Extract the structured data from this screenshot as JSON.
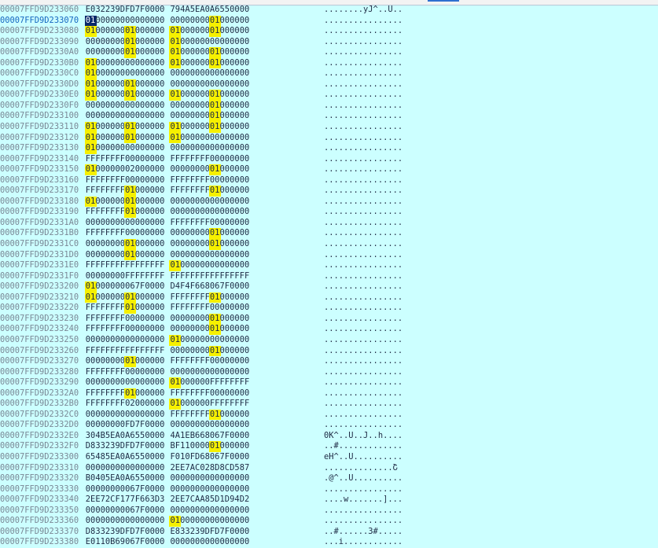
{
  "hex_view": {
    "rows": [
      {
        "address": "00007FFD9D233060",
        "bytes": [
          "E0",
          "32",
          "23",
          "9D",
          "FD",
          "7F",
          "00",
          "00",
          "79",
          "4A",
          "5E",
          "A0",
          "A6",
          "55",
          "00",
          "00"
        ],
        "ascii": "........yJ^..U.."
      },
      {
        "address": "00007FFD9D233070",
        "bytes": [
          "01",
          "00",
          "00",
          "00",
          "00",
          "00",
          "00",
          "00",
          "00",
          "00",
          "00",
          "00",
          "01",
          "00",
          "00",
          "00"
        ],
        "ascii": "................",
        "current": true
      },
      {
        "address": "00007FFD9D233080",
        "bytes": [
          "01",
          "00",
          "00",
          "00",
          "01",
          "00",
          "00",
          "00",
          "01",
          "00",
          "00",
          "00",
          "01",
          "00",
          "00",
          "00"
        ],
        "ascii": "................"
      },
      {
        "address": "00007FFD9D233090",
        "bytes": [
          "00",
          "00",
          "00",
          "00",
          "01",
          "00",
          "00",
          "00",
          "01",
          "00",
          "00",
          "00",
          "00",
          "00",
          "00",
          "00"
        ],
        "ascii": "................"
      },
      {
        "address": "00007FFD9D2330A0",
        "bytes": [
          "00",
          "00",
          "00",
          "00",
          "01",
          "00",
          "00",
          "00",
          "01",
          "00",
          "00",
          "00",
          "01",
          "00",
          "00",
          "00"
        ],
        "ascii": "................"
      },
      {
        "address": "00007FFD9D2330B0",
        "bytes": [
          "01",
          "00",
          "00",
          "00",
          "00",
          "00",
          "00",
          "00",
          "01",
          "00",
          "00",
          "00",
          "01",
          "00",
          "00",
          "00"
        ],
        "ascii": "................"
      },
      {
        "address": "00007FFD9D2330C0",
        "bytes": [
          "01",
          "00",
          "00",
          "00",
          "00",
          "00",
          "00",
          "00",
          "00",
          "00",
          "00",
          "00",
          "00",
          "00",
          "00",
          "00"
        ],
        "ascii": "................"
      },
      {
        "address": "00007FFD9D2330D0",
        "bytes": [
          "01",
          "00",
          "00",
          "00",
          "01",
          "00",
          "00",
          "00",
          "00",
          "00",
          "00",
          "00",
          "00",
          "00",
          "00",
          "00"
        ],
        "ascii": "................"
      },
      {
        "address": "00007FFD9D2330E0",
        "bytes": [
          "01",
          "00",
          "00",
          "00",
          "01",
          "00",
          "00",
          "00",
          "01",
          "00",
          "00",
          "00",
          "01",
          "00",
          "00",
          "00"
        ],
        "ascii": "................"
      },
      {
        "address": "00007FFD9D2330F0",
        "bytes": [
          "00",
          "00",
          "00",
          "00",
          "00",
          "00",
          "00",
          "00",
          "00",
          "00",
          "00",
          "00",
          "01",
          "00",
          "00",
          "00"
        ],
        "ascii": "................"
      },
      {
        "address": "00007FFD9D233100",
        "bytes": [
          "00",
          "00",
          "00",
          "00",
          "00",
          "00",
          "00",
          "00",
          "00",
          "00",
          "00",
          "00",
          "01",
          "00",
          "00",
          "00"
        ],
        "ascii": "................"
      },
      {
        "address": "00007FFD9D233110",
        "bytes": [
          "01",
          "00",
          "00",
          "00",
          "01",
          "00",
          "00",
          "00",
          "01",
          "00",
          "00",
          "00",
          "01",
          "00",
          "00",
          "00"
        ],
        "ascii": "................"
      },
      {
        "address": "00007FFD9D233120",
        "bytes": [
          "01",
          "00",
          "00",
          "00",
          "01",
          "00",
          "00",
          "00",
          "01",
          "00",
          "00",
          "00",
          "00",
          "00",
          "00",
          "00"
        ],
        "ascii": "................"
      },
      {
        "address": "00007FFD9D233130",
        "bytes": [
          "01",
          "00",
          "00",
          "00",
          "00",
          "00",
          "00",
          "00",
          "00",
          "00",
          "00",
          "00",
          "00",
          "00",
          "00",
          "00"
        ],
        "ascii": "................"
      },
      {
        "address": "00007FFD9D233140",
        "bytes": [
          "FF",
          "FF",
          "FF",
          "FF",
          "00",
          "00",
          "00",
          "00",
          "FF",
          "FF",
          "FF",
          "FF",
          "00",
          "00",
          "00",
          "00"
        ],
        "ascii": "................"
      },
      {
        "address": "00007FFD9D233150",
        "bytes": [
          "01",
          "00",
          "00",
          "00",
          "02",
          "00",
          "00",
          "00",
          "00",
          "00",
          "00",
          "00",
          "01",
          "00",
          "00",
          "00"
        ],
        "ascii": "................"
      },
      {
        "address": "00007FFD9D233160",
        "bytes": [
          "FF",
          "FF",
          "FF",
          "FF",
          "00",
          "00",
          "00",
          "00",
          "FF",
          "FF",
          "FF",
          "FF",
          "00",
          "00",
          "00",
          "00"
        ],
        "ascii": "................"
      },
      {
        "address": "00007FFD9D233170",
        "bytes": [
          "FF",
          "FF",
          "FF",
          "FF",
          "01",
          "00",
          "00",
          "00",
          "FF",
          "FF",
          "FF",
          "FF",
          "01",
          "00",
          "00",
          "00"
        ],
        "ascii": "................"
      },
      {
        "address": "00007FFD9D233180",
        "bytes": [
          "01",
          "00",
          "00",
          "00",
          "01",
          "00",
          "00",
          "00",
          "00",
          "00",
          "00",
          "00",
          "00",
          "00",
          "00",
          "00"
        ],
        "ascii": "................"
      },
      {
        "address": "00007FFD9D233190",
        "bytes": [
          "FF",
          "FF",
          "FF",
          "FF",
          "01",
          "00",
          "00",
          "00",
          "00",
          "00",
          "00",
          "00",
          "00",
          "00",
          "00",
          "00"
        ],
        "ascii": "................"
      },
      {
        "address": "00007FFD9D2331A0",
        "bytes": [
          "00",
          "00",
          "00",
          "00",
          "00",
          "00",
          "00",
          "00",
          "FF",
          "FF",
          "FF",
          "FF",
          "00",
          "00",
          "00",
          "00"
        ],
        "ascii": "................"
      },
      {
        "address": "00007FFD9D2331B0",
        "bytes": [
          "FF",
          "FF",
          "FF",
          "FF",
          "00",
          "00",
          "00",
          "00",
          "00",
          "00",
          "00",
          "00",
          "01",
          "00",
          "00",
          "00"
        ],
        "ascii": "................"
      },
      {
        "address": "00007FFD9D2331C0",
        "bytes": [
          "00",
          "00",
          "00",
          "00",
          "01",
          "00",
          "00",
          "00",
          "00",
          "00",
          "00",
          "00",
          "01",
          "00",
          "00",
          "00"
        ],
        "ascii": "................"
      },
      {
        "address": "00007FFD9D2331D0",
        "bytes": [
          "00",
          "00",
          "00",
          "00",
          "01",
          "00",
          "00",
          "00",
          "00",
          "00",
          "00",
          "00",
          "00",
          "00",
          "00",
          "00"
        ],
        "ascii": "................"
      },
      {
        "address": "00007FFD9D2331E0",
        "bytes": [
          "FF",
          "FF",
          "FF",
          "FF",
          "FF",
          "FF",
          "FF",
          "FF",
          "01",
          "00",
          "00",
          "00",
          "00",
          "00",
          "00",
          "00"
        ],
        "ascii": "................"
      },
      {
        "address": "00007FFD9D2331F0",
        "bytes": [
          "00",
          "00",
          "00",
          "00",
          "FF",
          "FF",
          "FF",
          "FF",
          "FF",
          "FF",
          "FF",
          "FF",
          "FF",
          "FF",
          "FF",
          "FF"
        ],
        "ascii": "................"
      },
      {
        "address": "00007FFD9D233200",
        "bytes": [
          "01",
          "00",
          "00",
          "00",
          "06",
          "7F",
          "00",
          "00",
          "D4",
          "F4",
          "F6",
          "68",
          "06",
          "7F",
          "00",
          "00"
        ],
        "ascii": "................"
      },
      {
        "address": "00007FFD9D233210",
        "bytes": [
          "01",
          "00",
          "00",
          "00",
          "01",
          "00",
          "00",
          "00",
          "FF",
          "FF",
          "FF",
          "FF",
          "01",
          "00",
          "00",
          "00"
        ],
        "ascii": "................"
      },
      {
        "address": "00007FFD9D233220",
        "bytes": [
          "FF",
          "FF",
          "FF",
          "FF",
          "01",
          "00",
          "00",
          "00",
          "FF",
          "FF",
          "FF",
          "FF",
          "00",
          "00",
          "00",
          "00"
        ],
        "ascii": "................"
      },
      {
        "address": "00007FFD9D233230",
        "bytes": [
          "FF",
          "FF",
          "FF",
          "FF",
          "00",
          "00",
          "00",
          "00",
          "00",
          "00",
          "00",
          "00",
          "01",
          "00",
          "00",
          "00"
        ],
        "ascii": "................"
      },
      {
        "address": "00007FFD9D233240",
        "bytes": [
          "FF",
          "FF",
          "FF",
          "FF",
          "00",
          "00",
          "00",
          "00",
          "00",
          "00",
          "00",
          "00",
          "01",
          "00",
          "00",
          "00"
        ],
        "ascii": "................"
      },
      {
        "address": "00007FFD9D233250",
        "bytes": [
          "00",
          "00",
          "00",
          "00",
          "00",
          "00",
          "00",
          "00",
          "01",
          "00",
          "00",
          "00",
          "00",
          "00",
          "00",
          "00"
        ],
        "ascii": "................"
      },
      {
        "address": "00007FFD9D233260",
        "bytes": [
          "FF",
          "FF",
          "FF",
          "FF",
          "FF",
          "FF",
          "FF",
          "FF",
          "00",
          "00",
          "00",
          "00",
          "01",
          "00",
          "00",
          "00"
        ],
        "ascii": "................"
      },
      {
        "address": "00007FFD9D233270",
        "bytes": [
          "00",
          "00",
          "00",
          "00",
          "01",
          "00",
          "00",
          "00",
          "FF",
          "FF",
          "FF",
          "FF",
          "00",
          "00",
          "00",
          "00"
        ],
        "ascii": "................"
      },
      {
        "address": "00007FFD9D233280",
        "bytes": [
          "FF",
          "FF",
          "FF",
          "FF",
          "00",
          "00",
          "00",
          "00",
          "00",
          "00",
          "00",
          "00",
          "00",
          "00",
          "00",
          "00"
        ],
        "ascii": "................"
      },
      {
        "address": "00007FFD9D233290",
        "bytes": [
          "00",
          "00",
          "00",
          "00",
          "00",
          "00",
          "00",
          "00",
          "01",
          "00",
          "00",
          "00",
          "FF",
          "FF",
          "FF",
          "FF"
        ],
        "ascii": "................"
      },
      {
        "address": "00007FFD9D2332A0",
        "bytes": [
          "FF",
          "FF",
          "FF",
          "FF",
          "01",
          "00",
          "00",
          "00",
          "FF",
          "FF",
          "FF",
          "FF",
          "00",
          "00",
          "00",
          "00"
        ],
        "ascii": "................"
      },
      {
        "address": "00007FFD9D2332B0",
        "bytes": [
          "FF",
          "FF",
          "FF",
          "FF",
          "02",
          "00",
          "00",
          "00",
          "01",
          "00",
          "00",
          "00",
          "FF",
          "FF",
          "FF",
          "FF"
        ],
        "ascii": "................"
      },
      {
        "address": "00007FFD9D2332C0",
        "bytes": [
          "00",
          "00",
          "00",
          "00",
          "00",
          "00",
          "00",
          "00",
          "FF",
          "FF",
          "FF",
          "FF",
          "01",
          "00",
          "00",
          "00"
        ],
        "ascii": "................"
      },
      {
        "address": "00007FFD9D2332D0",
        "bytes": [
          "00",
          "00",
          "00",
          "00",
          "FD",
          "7F",
          "00",
          "00",
          "00",
          "00",
          "00",
          "00",
          "00",
          "00",
          "00",
          "00"
        ],
        "ascii": "................"
      },
      {
        "address": "00007FFD9D2332E0",
        "bytes": [
          "30",
          "4B",
          "5E",
          "A0",
          "A6",
          "55",
          "00",
          "00",
          "4A",
          "1E",
          "B6",
          "68",
          "06",
          "7F",
          "00",
          "00"
        ],
        "ascii": "0K^..U..J..h...."
      },
      {
        "address": "00007FFD9D2332F0",
        "bytes": [
          "D8",
          "33",
          "23",
          "9D",
          "FD",
          "7F",
          "00",
          "00",
          "BF",
          "11",
          "00",
          "00",
          "01",
          "00",
          "00",
          "00"
        ],
        "ascii": "..#............."
      },
      {
        "address": "00007FFD9D233300",
        "bytes": [
          "65",
          "48",
          "5E",
          "A0",
          "A6",
          "55",
          "00",
          "00",
          "F0",
          "10",
          "FD",
          "68",
          "06",
          "7F",
          "00",
          "00"
        ],
        "ascii": "eH^..U.........."
      },
      {
        "address": "00007FFD9D233310",
        "bytes": [
          "00",
          "00",
          "00",
          "00",
          "00",
          "00",
          "00",
          "00",
          "2E",
          "E7",
          "AC",
          "02",
          "8D",
          "8C",
          "D5",
          "87"
        ],
        "ascii": "..............Շ"
      },
      {
        "address": "00007FFD9D233320",
        "bytes": [
          "B0",
          "40",
          "5E",
          "A0",
          "A6",
          "55",
          "00",
          "00",
          "00",
          "00",
          "00",
          "00",
          "00",
          "00",
          "00",
          "00"
        ],
        "ascii": ".@^..U.........."
      },
      {
        "address": "00007FFD9D233330",
        "bytes": [
          "00",
          "00",
          "00",
          "00",
          "06",
          "7F",
          "00",
          "00",
          "00",
          "00",
          "00",
          "00",
          "00",
          "00",
          "00",
          "00"
        ],
        "ascii": "................"
      },
      {
        "address": "00007FFD9D233340",
        "bytes": [
          "2E",
          "E7",
          "2C",
          "F1",
          "77",
          "F6",
          "63",
          "D3",
          "2E",
          "E7",
          "CA",
          "A8",
          "5D",
          "1D",
          "94",
          "D2"
        ],
        "ascii": "....w.......]..."
      },
      {
        "address": "00007FFD9D233350",
        "bytes": [
          "00",
          "00",
          "00",
          "00",
          "06",
          "7F",
          "00",
          "00",
          "00",
          "00",
          "00",
          "00",
          "00",
          "00",
          "00",
          "00"
        ],
        "ascii": "................"
      },
      {
        "address": "00007FFD9D233360",
        "bytes": [
          "00",
          "00",
          "00",
          "00",
          "00",
          "00",
          "00",
          "00",
          "01",
          "00",
          "00",
          "00",
          "00",
          "00",
          "00",
          "00"
        ],
        "ascii": "................"
      },
      {
        "address": "00007FFD9D233370",
        "bytes": [
          "D8",
          "33",
          "23",
          "9D",
          "FD",
          "7F",
          "00",
          "00",
          "E8",
          "33",
          "23",
          "9D",
          "FD",
          "7F",
          "00",
          "00"
        ],
        "ascii": "..#......3#....."
      },
      {
        "address": "00007FFD9D233380",
        "bytes": [
          "E0",
          "11",
          "0B",
          "69",
          "06",
          "7F",
          "00",
          "00",
          "00",
          "00",
          "00",
          "00",
          "00",
          "00",
          "00",
          "00"
        ],
        "ascii": "...i............"
      }
    ],
    "highlight_value": "01",
    "colors": {
      "background": "#ccffff",
      "highlight": "#f6f000",
      "address": "#7a8795",
      "current_address": "#1565c0"
    }
  }
}
